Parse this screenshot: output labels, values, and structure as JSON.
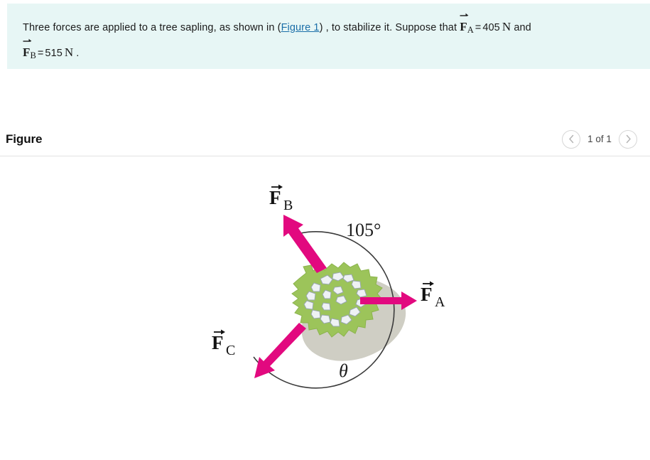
{
  "problem": {
    "line1_part1": "Three forces are applied to a tree sapling, as shown in (",
    "figure_link": "Figure 1",
    "line1_part2": ") , to stabilize it. Suppose that",
    "force_a_symbol": "F",
    "force_a_sub": "A",
    "force_a_equals": "=",
    "force_a_value": "405",
    "force_a_unit": "N",
    "conjunction": "and",
    "force_b_symbol": "F",
    "force_b_sub": "B",
    "force_b_equals": "=",
    "force_b_value": "515",
    "force_b_unit": "N",
    "period": "."
  },
  "figure": {
    "title": "Figure",
    "pager_count": "1 of 1",
    "prev_icon": "chevron-left-icon",
    "next_icon": "chevron-right-icon"
  },
  "diagram": {
    "label_fb": "F",
    "label_fb_sub": "B",
    "label_fa": "F",
    "label_fa_sub": "A",
    "label_fc": "F",
    "label_fc_sub": "C",
    "angle_105": "105°",
    "angle_theta": "θ",
    "arrow_color": "#e2097f",
    "foliage_color": "#9cc45a",
    "shadow_color": "#cfcec4",
    "branch_color": "#e9eef0",
    "branch_outline": "#98a7ad",
    "arc_color": "#3b3b3b"
  },
  "colors": {
    "panel_background": "#e7f6f5",
    "link": "#1a6ea8",
    "divider": "#e3e3e3"
  }
}
